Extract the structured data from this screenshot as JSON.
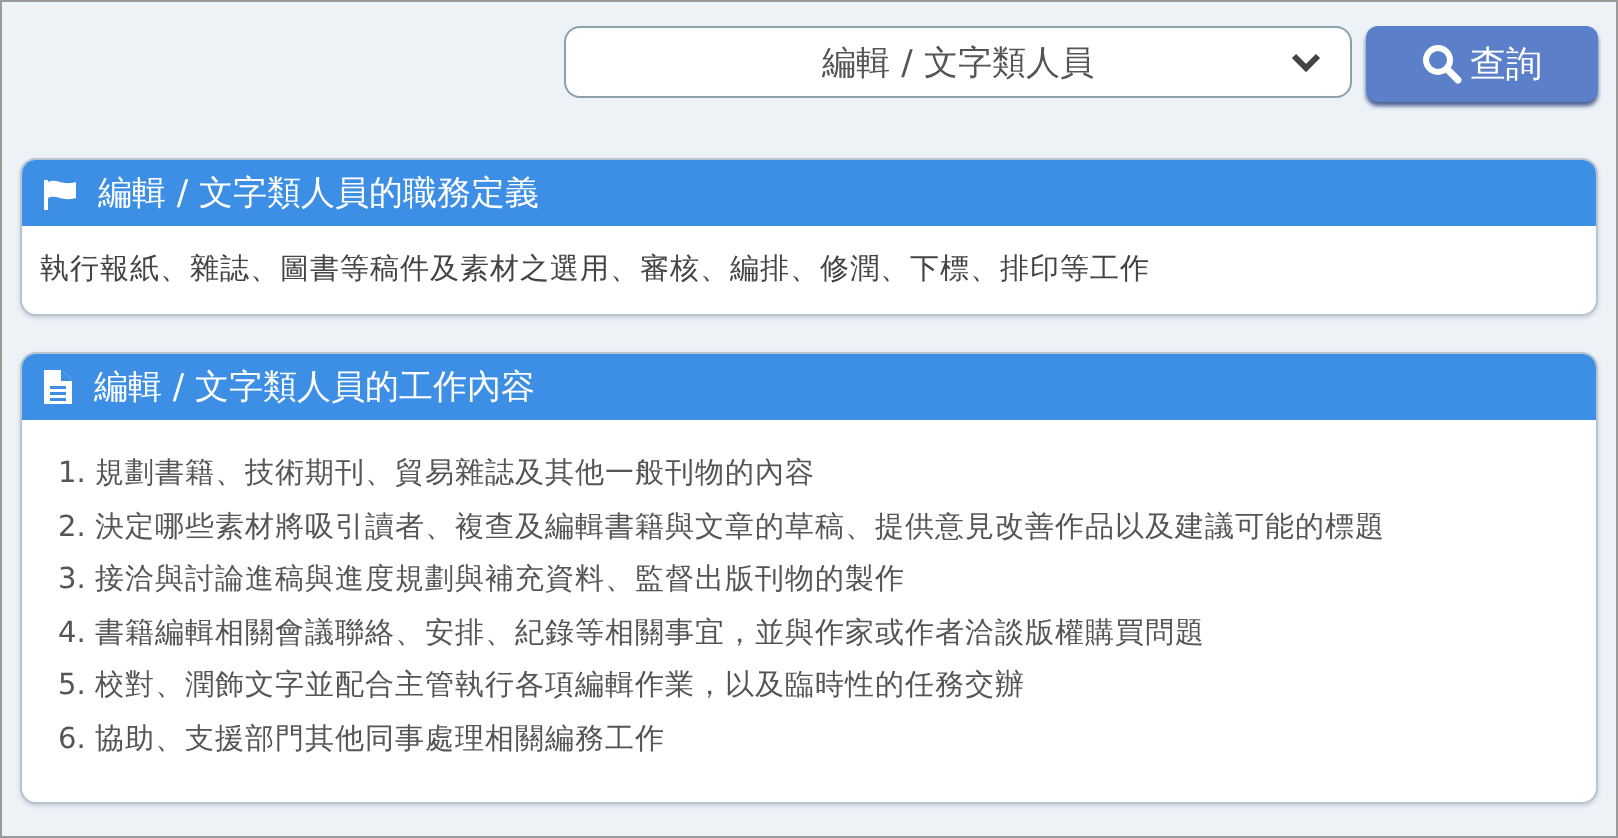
{
  "search": {
    "selected_value": "編輯 / 文字類人員",
    "button": "查詢"
  },
  "panels": [
    {
      "kind": "paragraph",
      "title": "編輯 / 文字類人員的職務定義",
      "text": "執行報紙、雜誌、圖書等稿件及素材之選用、審核、編排、修潤、下標、排印等工作"
    },
    {
      "kind": "list",
      "title": "編輯 / 文字類人員的工作內容",
      "items": [
        "1. 規劃書籍、技術期刊、貿易雜誌及其他一般刊物的內容",
        "2. 決定哪些素材將吸引讀者、複查及編輯書籍與文章的草稿、提供意見改善作品以及建議可能的標題",
        "3. 接洽與討論進稿與進度規劃與補充資料、監督出版刊物的製作",
        "4. 書籍編輯相關會議聯絡、安排、紀錄等相關事宜，並與作家或作者洽談版權購買問題",
        "5. 校對、潤飾文字並配合主管執行各項編輯作業，以及臨時性的任務交辦",
        "6. 協助、支援部門其他同事處理相關編務工作"
      ]
    }
  ]
}
